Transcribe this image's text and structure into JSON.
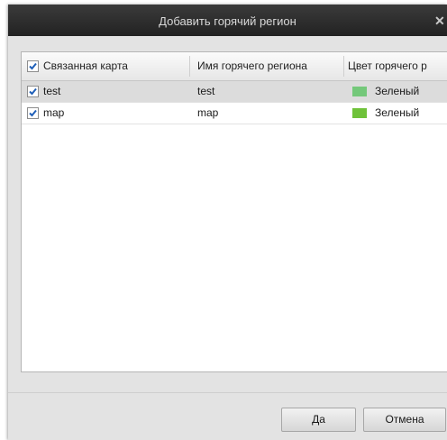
{
  "dialog": {
    "title": "Добавить горячий регион",
    "close_glyph": "✕"
  },
  "table": {
    "columns": [
      "Связанная карта",
      "Имя горячего региона",
      "Цвет горячего р"
    ],
    "header_checked": true,
    "rows": [
      {
        "map": "test",
        "name": "test",
        "color_label": "Зеленый",
        "color": "#74c87a",
        "checked": true,
        "selected": true
      },
      {
        "map": "map",
        "name": "map",
        "color_label": "Зеленый",
        "color": "#6fc23a",
        "checked": true,
        "selected": false
      }
    ]
  },
  "buttons": {
    "ok": "Да",
    "cancel": "Отмена"
  }
}
